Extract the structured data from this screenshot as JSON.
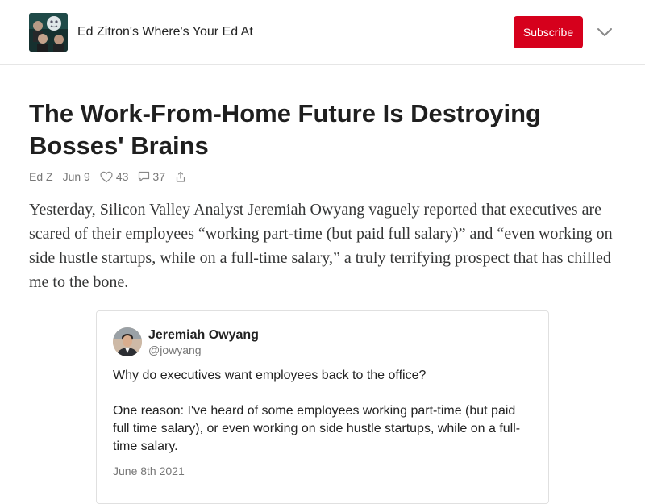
{
  "header": {
    "publication_name": "Ed Zitron's Where's Your Ed At",
    "subscribe_label": "Subscribe",
    "logo_icon": "publication-logo-icon",
    "menu_icon": "chevron-down-icon"
  },
  "post": {
    "title": "The Work-From-Home Future Is Destroying Bosses' Brains",
    "author": "Ed Z",
    "date": "Jun 9",
    "likes": "43",
    "comments": "37",
    "body": "Yesterday, Silicon Valley Analyst Jeremiah Owyang vaguely reported that executives are scared of their employees “working part-time (but paid full salary)” and “even working on side hustle startups, while on a full-time salary,” a truly terrifying prospect that has chilled me to the bone."
  },
  "tweet": {
    "name": "Jeremiah Owyang",
    "handle": "@jowyang",
    "paragraphs": [
      "Why do executives want employees back to the office?",
      "One reason: I've heard of some employees working part-time (but paid full time salary), or even working on side hustle startups, while on a full-time salary."
    ],
    "date": "June 8th 2021"
  },
  "colors": {
    "accent": "#d6001c",
    "meta_text": "#777777",
    "body_text": "#363737"
  }
}
